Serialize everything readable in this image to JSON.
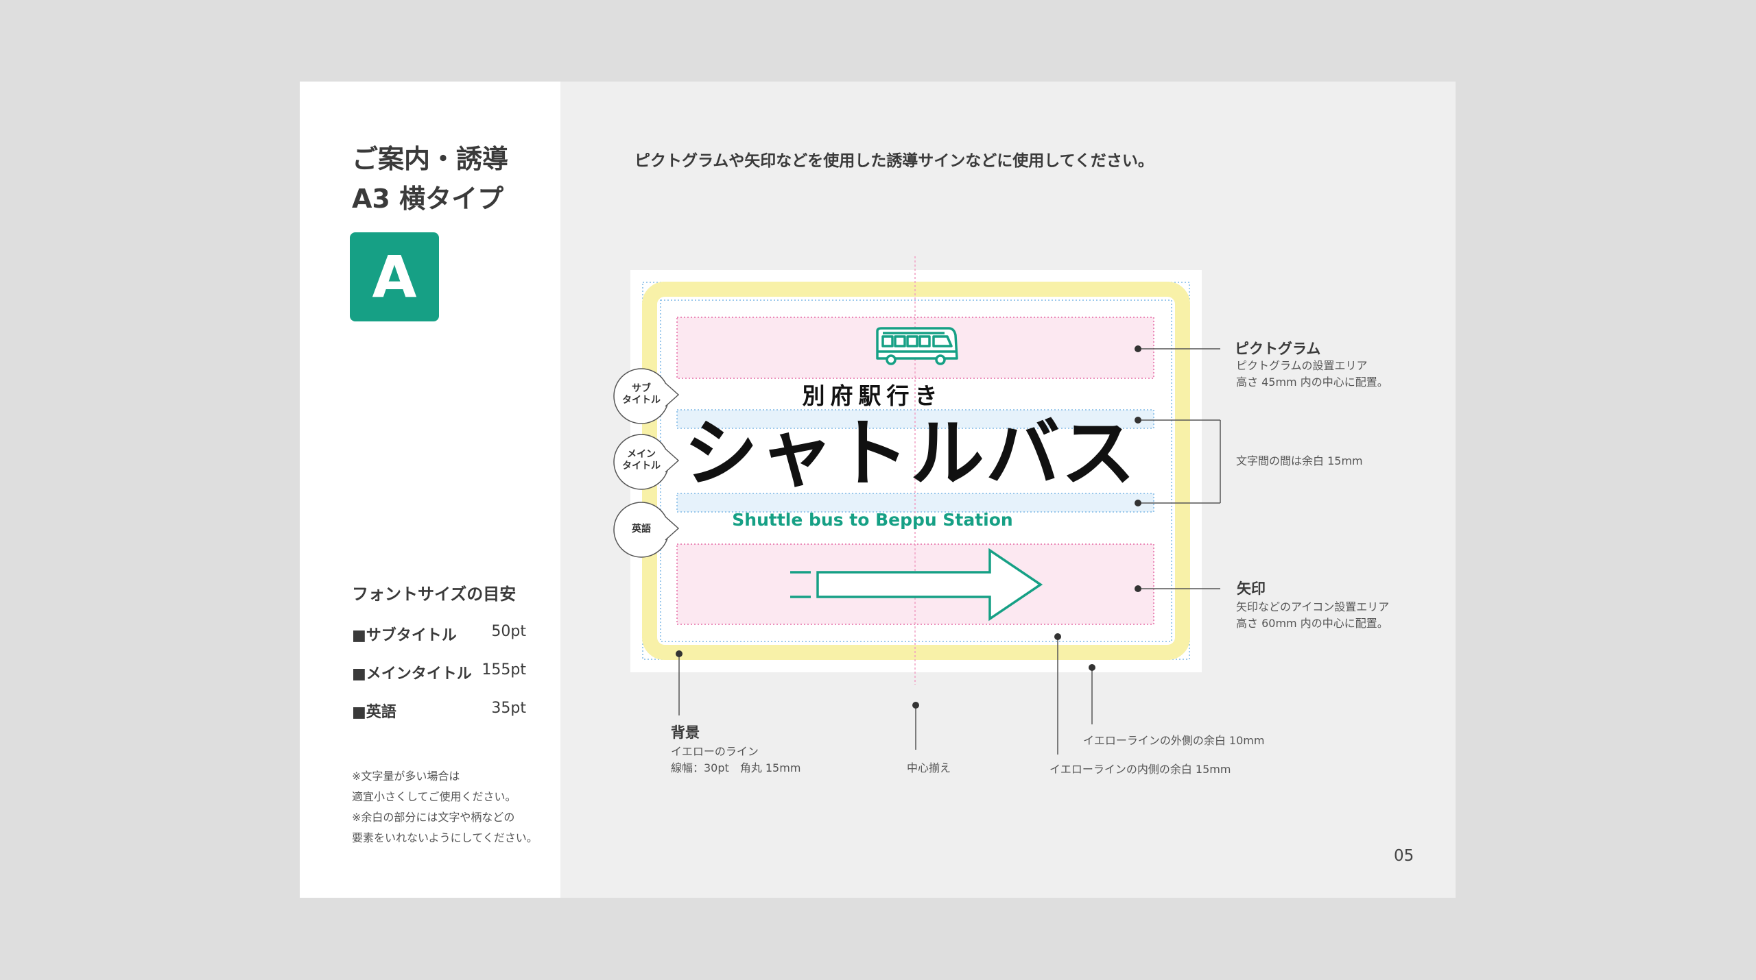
{
  "sidebar": {
    "title_line1": "ご案内・誘導",
    "title_line2": "A3 横タイプ",
    "badge": "A",
    "font_size_heading": "フォントサイズの目安",
    "font_sizes": [
      {
        "label": "■サブタイトル",
        "value": "50pt"
      },
      {
        "label": "■メインタイトル",
        "value": "155pt"
      },
      {
        "label": "■英語",
        "value": "35pt"
      }
    ],
    "notes": [
      "※文字量が多い場合は",
      "適宜小さくしてご使用ください。",
      "※余白の部分には文字や柄などの",
      "要素をいれないようにしてください。"
    ]
  },
  "intro_text": "ピクトグラムや矢印などを使用した誘導サインなどに使用してください。",
  "sign": {
    "subtitle": "別府駅行き",
    "main_title": "シャトルバス",
    "english": "Shuttle bus to Beppu Station",
    "pictogram_icon": "bus-icon",
    "arrow_icon": "right-arrow-icon"
  },
  "bubbles": [
    {
      "line1": "サブ",
      "line2": "タイトル"
    },
    {
      "line1": "メイン",
      "line2": "タイトル"
    },
    {
      "line1": "英語",
      "line2": ""
    }
  ],
  "annotations": {
    "pictogram": {
      "head": "ピクトグラム",
      "line1": "ピクトグラムの設置エリア",
      "line2": "高さ 45mm 内の中心に配置。"
    },
    "spacing": {
      "text": "文字間の間は余白 15mm"
    },
    "arrow": {
      "head": "矢印",
      "line1": "矢印などのアイコン設置エリア",
      "line2": "高さ 60mm 内の中心に配置。"
    },
    "background": {
      "head": "背景",
      "line1": "イエローのライン",
      "line2": "線幅：30pt　角丸 15mm"
    },
    "center": {
      "text": "中心揃え"
    },
    "yellow_outer": {
      "text": "イエローラインの外側の余白 10mm"
    },
    "yellow_inner": {
      "text": "イエローラインの内側の余白 15mm"
    }
  },
  "page_number": "05",
  "colors": {
    "accent": "#16a085",
    "yellow": "#f9f3b0",
    "pink_area": "#fce8f1",
    "blue_area": "#e6f2fb"
  }
}
